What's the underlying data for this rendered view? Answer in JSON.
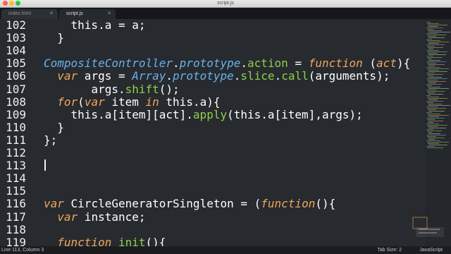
{
  "window": {
    "title": "script.js"
  },
  "tabs": [
    {
      "label": "index.html",
      "active": false
    },
    {
      "label": "script.js",
      "active": true
    }
  ],
  "editor": {
    "lines": [
      {
        "num": "102",
        "tokens": [
          [
            "    ",
            "t"
          ],
          [
            "this",
            "t"
          ],
          [
            ".a = a;",
            "t"
          ]
        ]
      },
      {
        "num": "103",
        "tokens": [
          [
            "  }",
            "t"
          ]
        ]
      },
      {
        "num": "104",
        "tokens": []
      },
      {
        "num": "105",
        "tokens": [
          [
            "CompositeController",
            "cls"
          ],
          [
            ".",
            "t"
          ],
          [
            "prototype",
            "cls"
          ],
          [
            ".",
            "t"
          ],
          [
            "action",
            "fn"
          ],
          [
            " = ",
            "t"
          ],
          [
            "function",
            "k"
          ],
          [
            " (",
            "t"
          ],
          [
            "act",
            "k"
          ],
          [
            "){",
            "t"
          ]
        ]
      },
      {
        "num": "106",
        "tokens": [
          [
            "  ",
            "t"
          ],
          [
            "var",
            "k"
          ],
          [
            " args = ",
            "t"
          ],
          [
            "Array",
            "cls"
          ],
          [
            ".",
            "t"
          ],
          [
            "prototype",
            "cls"
          ],
          [
            ".",
            "t"
          ],
          [
            "slice",
            "fn"
          ],
          [
            ".",
            "t"
          ],
          [
            "call",
            "fn"
          ],
          [
            "(arguments);",
            "t"
          ]
        ]
      },
      {
        "num": "107",
        "tokens": [
          [
            "       args.",
            "t"
          ],
          [
            "shift",
            "fn"
          ],
          [
            "();",
            "t"
          ]
        ]
      },
      {
        "num": "108",
        "tokens": [
          [
            "  ",
            "t"
          ],
          [
            "for",
            "k"
          ],
          [
            "(",
            "t"
          ],
          [
            "var",
            "k"
          ],
          [
            " item ",
            "t"
          ],
          [
            "in",
            "k"
          ],
          [
            " this.a){",
            "t"
          ]
        ]
      },
      {
        "num": "109",
        "tokens": [
          [
            "    this.a[item][act].",
            "t"
          ],
          [
            "apply",
            "fn"
          ],
          [
            "(this.a[item],args);",
            "t"
          ]
        ]
      },
      {
        "num": "110",
        "tokens": [
          [
            "  }",
            "t"
          ]
        ]
      },
      {
        "num": "111",
        "tokens": [
          [
            "};",
            "t"
          ]
        ]
      },
      {
        "num": "112",
        "tokens": []
      },
      {
        "num": "113",
        "tokens": []
      },
      {
        "num": "114",
        "tokens": []
      },
      {
        "num": "115",
        "tokens": []
      },
      {
        "num": "116",
        "tokens": [
          [
            "var",
            "k"
          ],
          [
            " CircleGeneratorSingleton = (",
            "t"
          ],
          [
            "function",
            "k"
          ],
          [
            "(){",
            "t"
          ]
        ]
      },
      {
        "num": "117",
        "tokens": [
          [
            "  ",
            "t"
          ],
          [
            "var",
            "k"
          ],
          [
            " instance;",
            "t"
          ]
        ]
      },
      {
        "num": "118",
        "tokens": []
      },
      {
        "num": "119",
        "tokens": [
          [
            "  ",
            "t"
          ],
          [
            "function",
            "k"
          ],
          [
            " ",
            "t"
          ],
          [
            "init",
            "fn"
          ],
          [
            "(){",
            "t"
          ]
        ]
      }
    ]
  },
  "status": {
    "position": "Line 113, Column 3",
    "tab_size": "Tab Size: 2",
    "syntax": "JavaScript"
  },
  "colors": {
    "background": "#272a2f",
    "keyword": "#f0a65a",
    "class": "#69b2e8",
    "function": "#8fd14a"
  }
}
